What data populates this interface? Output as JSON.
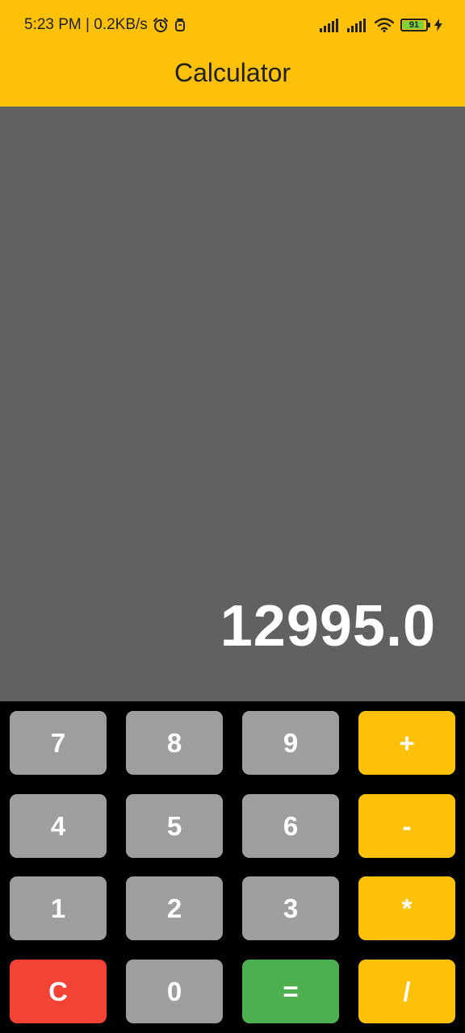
{
  "status_bar": {
    "time_speed": "5:23 PM | 0.2KB/s",
    "battery_level": "91",
    "icons": [
      "alarm-icon",
      "notification-icon",
      "signal-icon",
      "signal-icon",
      "wifi-icon",
      "battery-icon",
      "charging-icon"
    ]
  },
  "app_bar": {
    "title": "Calculator"
  },
  "display": {
    "value": "12995.0"
  },
  "keypad": {
    "row1": [
      "7",
      "8",
      "9",
      "+"
    ],
    "row2": [
      "4",
      "5",
      "6",
      "-"
    ],
    "row3": [
      "1",
      "2",
      "3",
      "*"
    ],
    "row4": [
      "C",
      "0",
      "=",
      "/"
    ]
  },
  "colors": {
    "accent": "#FFC107",
    "display_bg": "#616161",
    "number_key": "#9E9E9E",
    "clear_key": "#F44336",
    "equals_key": "#4CAF50",
    "keypad_bg": "#000000"
  }
}
